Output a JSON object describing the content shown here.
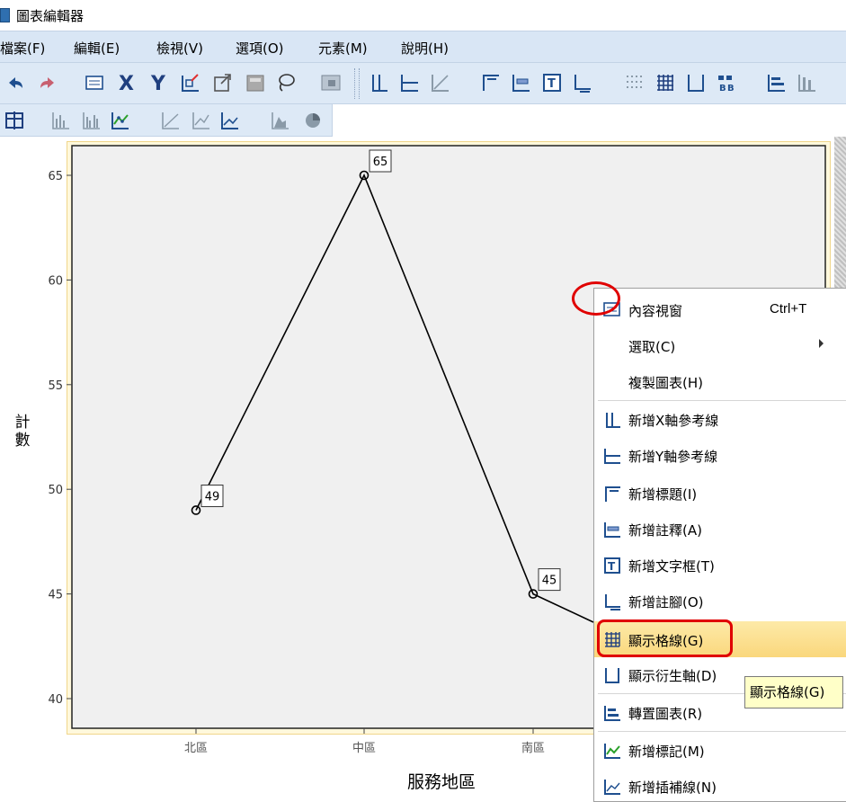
{
  "window": {
    "title": "圖表編輯器"
  },
  "menubar": {
    "items": [
      {
        "label": "檔案(F)"
      },
      {
        "label": "編輯(E)"
      },
      {
        "label": "檢視(V)"
      },
      {
        "label": "選項(O)"
      },
      {
        "label": "元素(M)"
      },
      {
        "label": "說明(H)"
      }
    ]
  },
  "toolbar": {
    "icons": [
      "undo-icon",
      "redo-icon",
      "properties-icon",
      "x-axis-select-icon",
      "y-axis-select-icon",
      "rescale-chart-icon",
      "restore-chart-icon",
      "data-cursor-icon",
      "lasso-icon",
      "chart-layout-icon",
      "x-ref-line-icon",
      "y-ref-line-icon",
      "equation-ref-line-icon",
      "title-icon",
      "annotation-icon",
      "text-box-icon",
      "footnote-icon",
      "show-grid-icon",
      "show-grid-lines-icon",
      "show-derived-axis-icon",
      "legend-icon",
      "transpose-icon",
      "bar-chart-icon"
    ],
    "icons_row2": [
      "table-icon",
      "bar-chart-icon",
      "clustered-bar-icon",
      "marker-icon",
      "fit-line-icon",
      "interpolation-icon",
      "line-icon",
      "area-icon",
      "pie-icon"
    ]
  },
  "chart_data": {
    "type": "line",
    "categories": [
      "北區",
      "中區",
      "南區"
    ],
    "values": [
      49,
      65,
      45
    ],
    "data_labels": [
      "49",
      "65",
      "45"
    ],
    "xlabel": "服務地區",
    "ylabel": "計數",
    "ylim": [
      40,
      65
    ],
    "yticks": [
      "40",
      "45",
      "50",
      "55",
      "60",
      "65"
    ],
    "grid": false,
    "colors": {
      "line": "#000000",
      "plot_bg": "#f0f0f0",
      "frame": "#fff8dc"
    }
  },
  "context_menu": {
    "items": [
      {
        "label": "內容視窗",
        "shortcut": "Ctrl+T",
        "icon": "properties-icon"
      },
      {
        "label": "選取(C)",
        "submenu": true
      },
      {
        "label": "複製圖表(H)"
      },
      {
        "label": "新增X軸參考線",
        "icon": "x-ref-line-icon"
      },
      {
        "label": "新增Y軸參考線",
        "icon": "y-ref-line-icon"
      },
      {
        "label": "新增標題(I)",
        "icon": "title-icon"
      },
      {
        "label": "新增註釋(A)",
        "icon": "annotation-icon"
      },
      {
        "label": "新增文字框(T)",
        "icon": "text-box-icon"
      },
      {
        "label": "新增註腳(O)",
        "icon": "footnote-icon"
      },
      {
        "label": "顯示格線(G)",
        "icon": "show-grid-icon",
        "highlighted": true
      },
      {
        "label": "顯示衍生軸(D)",
        "icon": "derived-axis-icon"
      },
      {
        "label": "轉置圖表(R)",
        "icon": "transpose-icon"
      },
      {
        "label": "新增標記(M)",
        "icon": "marker-icon"
      },
      {
        "label": "新增插補線(N)",
        "icon": "interpolation-icon"
      }
    ]
  },
  "tooltip": {
    "text": "顯示格線(G)"
  },
  "colors": {
    "highlight": "#fad77c",
    "annotation_red": "#e00000",
    "menubar": "#d9e6f5"
  }
}
